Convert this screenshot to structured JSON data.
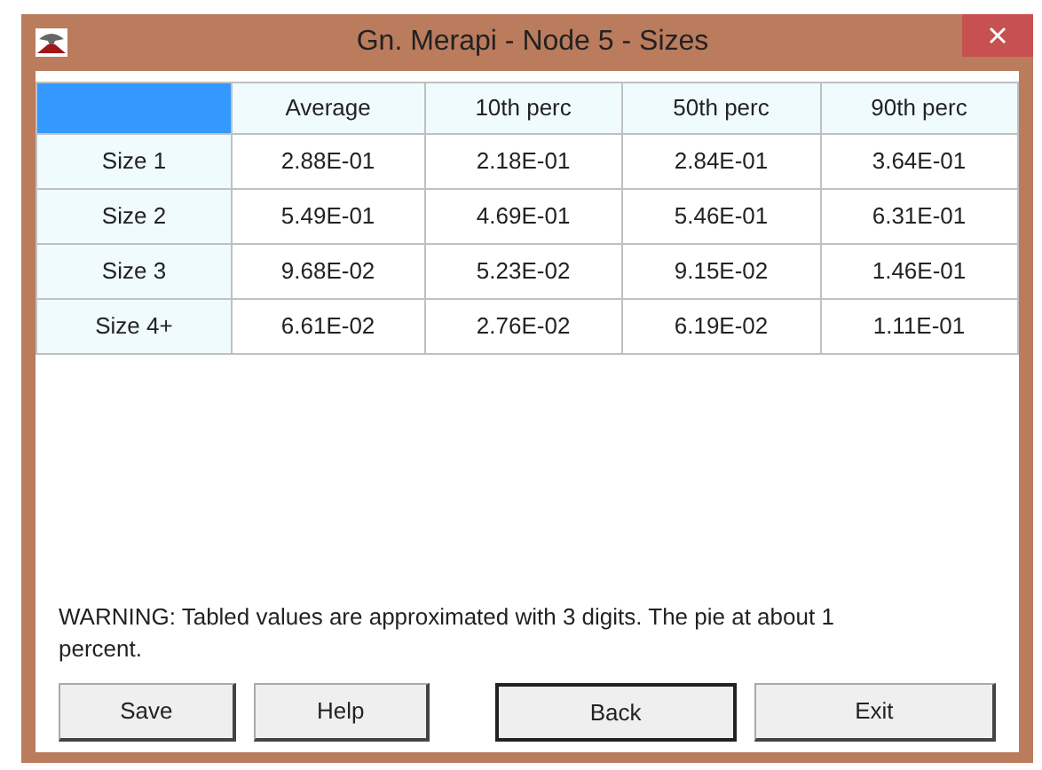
{
  "window": {
    "title": "Gn. Merapi - Node 5 - Sizes"
  },
  "table": {
    "columns": [
      "Average",
      "10th perc",
      "50th perc",
      "90th perc"
    ],
    "rows": [
      {
        "label": "Size 1",
        "cells": [
          "2.88E-01",
          "2.18E-01",
          "2.84E-01",
          "3.64E-01"
        ]
      },
      {
        "label": "Size 2",
        "cells": [
          "5.49E-01",
          "4.69E-01",
          "5.46E-01",
          "6.31E-01"
        ]
      },
      {
        "label": "Size 3",
        "cells": [
          "9.68E-02",
          "5.23E-02",
          "9.15E-02",
          "1.46E-01"
        ]
      },
      {
        "label": "Size 4+",
        "cells": [
          "6.61E-02",
          "2.76E-02",
          "6.19E-02",
          "1.11E-01"
        ]
      }
    ]
  },
  "warning": "WARNING: Tabled values are approximated with 3 digits. The pie at about 1 percent.",
  "buttons": [
    {
      "label": "Save",
      "default": false
    },
    {
      "label": "Help",
      "default": false
    },
    {
      "label": "Back",
      "default": true
    },
    {
      "label": "Exit",
      "default": false
    }
  ]
}
